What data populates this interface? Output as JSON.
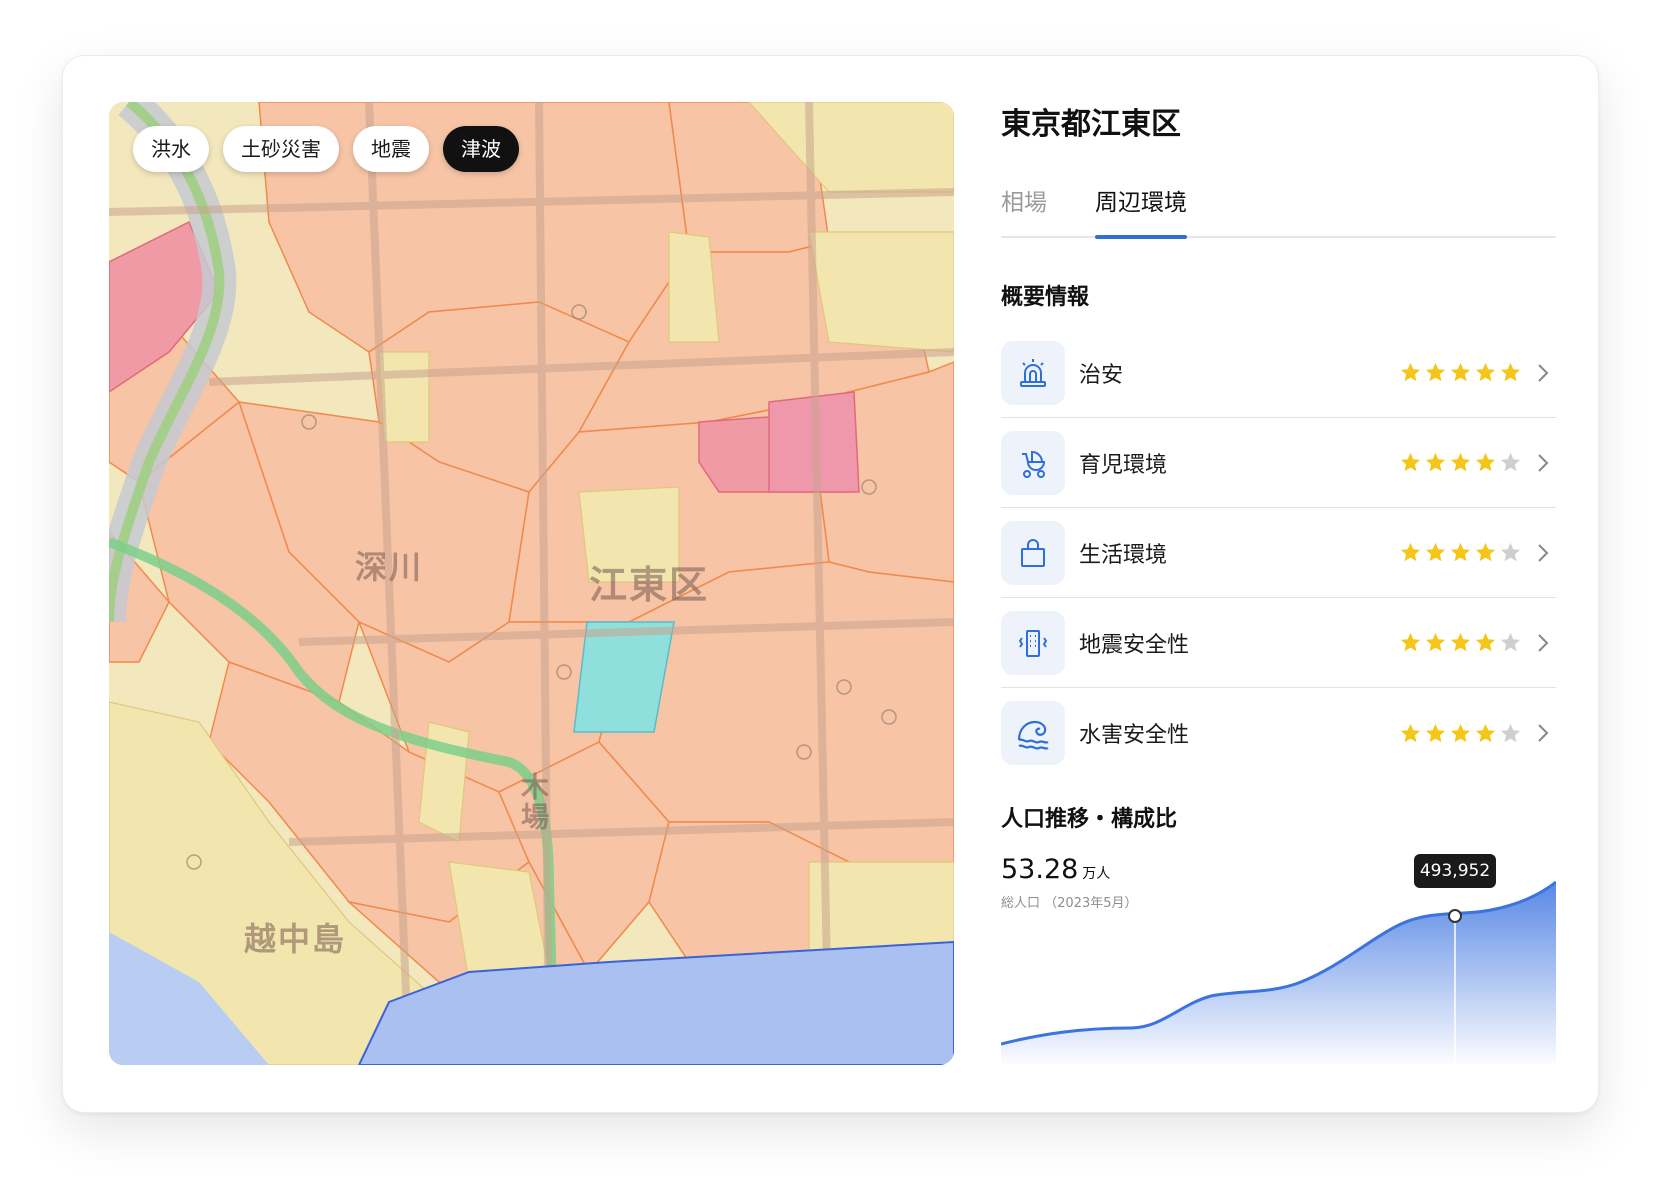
{
  "map": {
    "chips": [
      "洪水",
      "土砂災害",
      "地震",
      "津波"
    ],
    "active_chip": 3,
    "labels": [
      "深川",
      "江東区",
      "越中島",
      "木場"
    ]
  },
  "panel": {
    "title": "東京都江東区",
    "tabs": [
      {
        "label": "相場",
        "active": false
      },
      {
        "label": "周辺環境",
        "active": true
      }
    ],
    "overview_title": "概要情報",
    "items": [
      {
        "label": "治安",
        "icon": "siren-icon",
        "rating": 5
      },
      {
        "label": "育児環境",
        "icon": "baby-stroller-icon",
        "rating": 4
      },
      {
        "label": "生活環境",
        "icon": "shopping-bag-icon",
        "rating": 4
      },
      {
        "label": "地震安全性",
        "icon": "building-shake-icon",
        "rating": 4
      },
      {
        "label": "水害安全性",
        "icon": "wave-icon",
        "rating": 4
      }
    ],
    "population": {
      "title": "人口推移・構成比",
      "value": "53.28",
      "unit": "万人",
      "subtitle": "総人口 （2023年5月）",
      "tooltip": "493,952"
    }
  },
  "colors": {
    "accent": "#2f6fdc",
    "star": "#f5c518",
    "star_empty": "#cfcfcf",
    "chart_fill": "#3b73e0"
  }
}
